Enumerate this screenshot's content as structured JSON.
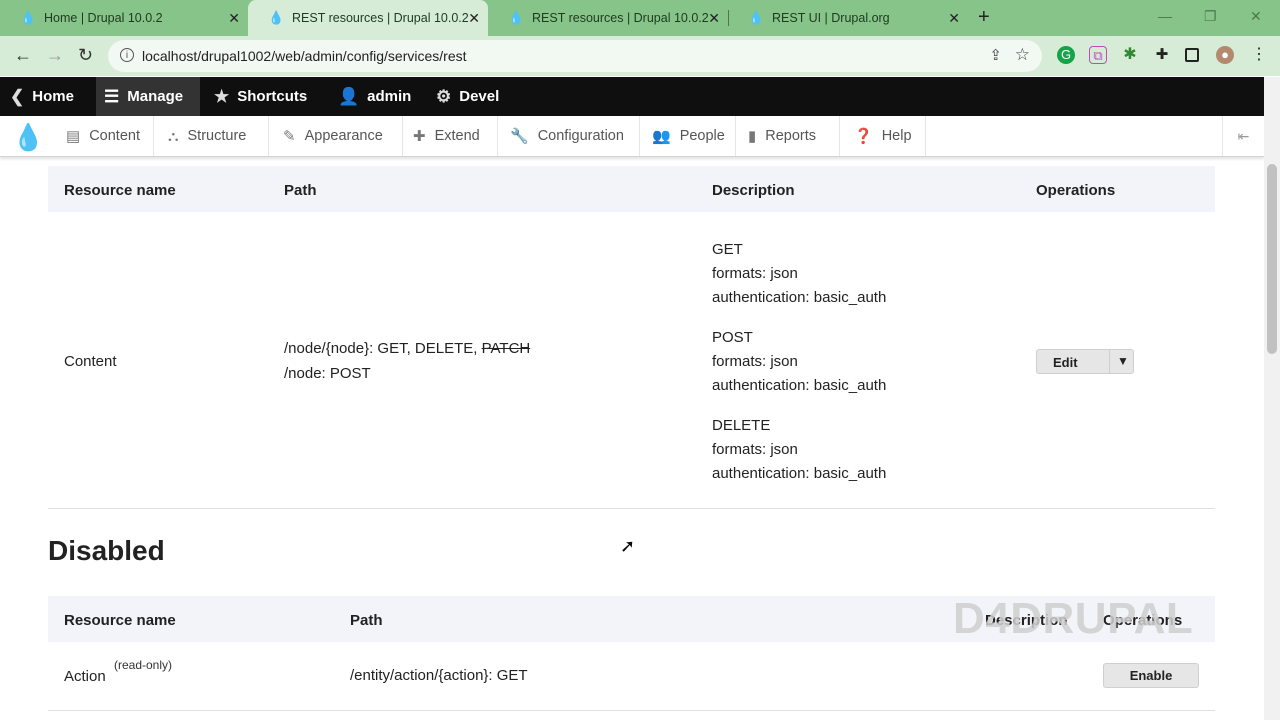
{
  "browser": {
    "tabs": [
      {
        "title": "Home | Drupal 10.0.2"
      },
      {
        "title": "REST resources | Drupal 10.0.2"
      },
      {
        "title": "REST resources | Drupal 10.0.2"
      },
      {
        "title": "REST UI | Drupal.org"
      }
    ],
    "active_tab": 1,
    "url": "localhost/drupal1002/web/admin/config/services/rest"
  },
  "admin_toolbar": {
    "items": [
      {
        "label": "Home",
        "icon": "drupal-back-icon"
      },
      {
        "label": "Manage",
        "icon": "hamburger-icon"
      },
      {
        "label": "Shortcuts",
        "icon": "star-icon"
      },
      {
        "label": "admin",
        "icon": "user-icon"
      },
      {
        "label": "Devel",
        "icon": "gear-icon"
      }
    ]
  },
  "manage_tray": {
    "items": [
      {
        "label": "Content",
        "icon": "document-icon"
      },
      {
        "label": "Structure",
        "icon": "structure-icon"
      },
      {
        "label": "Appearance",
        "icon": "brush-icon"
      },
      {
        "label": "Extend",
        "icon": "puzzle-icon"
      },
      {
        "label": "Configuration",
        "icon": "wrench-icon"
      },
      {
        "label": "People",
        "icon": "people-icon"
      },
      {
        "label": "Reports",
        "icon": "bar-chart-icon"
      },
      {
        "label": "Help",
        "icon": "help-icon"
      }
    ]
  },
  "enabled_table": {
    "headers": [
      "Resource name",
      "Path",
      "Description",
      "Operations"
    ],
    "row": {
      "name": "Content",
      "path_line1_prefix": "/node/{node}: GET, DELETE, ",
      "path_line1_strike": "PATCH",
      "path_line2": "/node: POST",
      "description": [
        "GET",
        "formats: json",
        "authentication: basic_auth",
        "POST",
        "formats: json",
        "authentication: basic_auth",
        "DELETE",
        "formats: json",
        "authentication: basic_auth"
      ],
      "operation": "Edit"
    }
  },
  "disabled_section": {
    "title": "Disabled",
    "headers": [
      "Resource name",
      "Path",
      "Description",
      "Operations"
    ],
    "row": {
      "name": "Action",
      "note": "(read-only)",
      "path": "/entity/action/{action}: GET",
      "operation": "Enable"
    }
  },
  "watermark": "D4DRUPAL"
}
